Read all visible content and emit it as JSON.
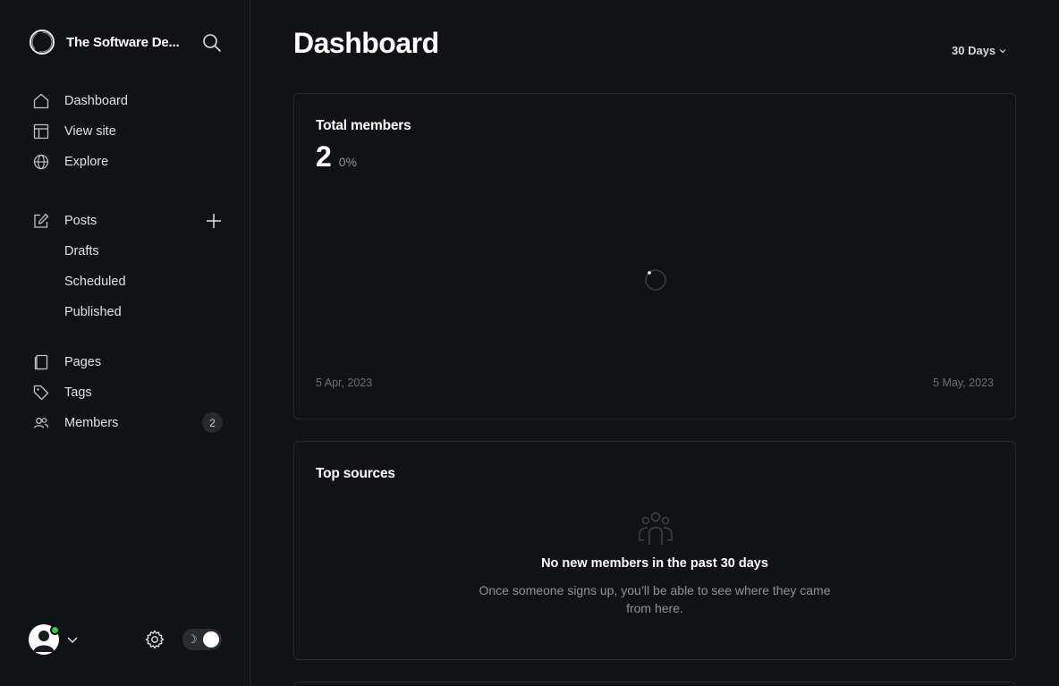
{
  "sidebar": {
    "site_title": "The Software De...",
    "nav": {
      "dashboard": "Dashboard",
      "view_site": "View site",
      "explore": "Explore",
      "posts": "Posts",
      "drafts": "Drafts",
      "scheduled": "Scheduled",
      "published": "Published",
      "pages": "Pages",
      "tags": "Tags",
      "members": "Members",
      "members_count": "2"
    },
    "icons": {
      "search": "search-icon",
      "dashboard": "home-icon",
      "view_site": "layout-icon",
      "explore": "globe-icon",
      "posts": "edit-icon",
      "add_post": "plus-icon",
      "pages": "page-icon",
      "tags": "tag-icon",
      "members": "members-icon",
      "settings": "gear-icon"
    },
    "footer": {
      "theme_toggle_symbol": "☽",
      "online_status_color": "#30cf43"
    }
  },
  "header": {
    "title": "Dashboard",
    "range": "30 Days"
  },
  "cards": {
    "members": {
      "title": "Total members",
      "value": "2",
      "change": "0%",
      "date_start": "5 Apr, 2023",
      "date_end": "5 May, 2023"
    },
    "sources": {
      "title": "Top sources",
      "empty_title": "No new members in the past 30 days",
      "empty_desc": "Once someone signs up, you’ll be able to see where they came from here."
    }
  },
  "colors": {
    "background": "#111215",
    "border": "#26282c",
    "text_primary": "#ffffff",
    "text_muted": "#8e9299"
  }
}
